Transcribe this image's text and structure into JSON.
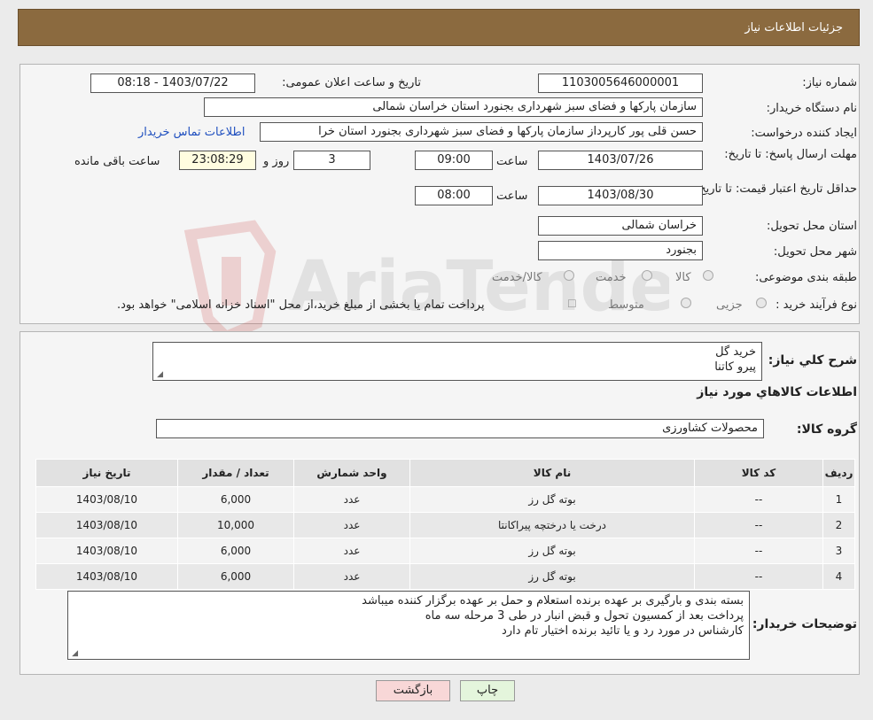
{
  "header": {
    "title": "جزئیات اطلاعات نیاز"
  },
  "form": {
    "need_number_label": "شماره نیاز:",
    "need_number": "1103005646000001",
    "announce_label": "تاریخ و ساعت اعلان عمومی:",
    "announce_value": "1403/07/22 - 08:18",
    "buyer_org_label": "نام دستگاه خریدار:",
    "buyer_org": "سازمان پارکها و فضای سبز شهرداری بجنورد استان خراسان شمالی",
    "requester_label": "ایجاد کننده درخواست:",
    "requester": "حسن  قلی پور  کارپرداز سازمان پارکها و فضای سبز شهرداری بجنورد استان خرا",
    "contact_link": "اطلاعات تماس خریدار",
    "deadline_label": "مهلت ارسال پاسخ: تا تاریخ:",
    "deadline_date": "1403/07/26",
    "time_word": "ساعت",
    "deadline_time": "09:00",
    "days": "3",
    "day_word": "روز و",
    "remaining": "23:08:29",
    "remaining_label": "ساعت باقی مانده",
    "validity_label": "حداقل تاریخ اعتبار قیمت: تا تاریخ:",
    "validity_date": "1403/08/30",
    "validity_time": "08:00",
    "province_label": "استان محل تحویل:",
    "province": "خراسان شمالی",
    "city_label": "شهر محل تحویل:",
    "city": "بجنورد",
    "category_label": "طبقه بندی موضوعی:",
    "category_options": [
      "کالا",
      "خدمت",
      "کالا/خدمت"
    ],
    "process_label": "نوع فرآیند خرید :",
    "process_options": [
      "جزیی",
      "متوسط"
    ],
    "process_note": "پرداخت تمام یا بخشی از مبلغ خرید،از محل \"اسناد خزانه اسلامی\" خواهد بود."
  },
  "summary": {
    "label": "شرح کلي نياز:",
    "lines": [
      "خرید گل",
      "پیرو کاتنا"
    ]
  },
  "goods": {
    "title": "اطلاعات کالاهاي مورد نياز",
    "group_label": "گروه کالا:",
    "group_value": "محصولات کشاورزی"
  },
  "table": {
    "headers": [
      "ردیف",
      "کد کالا",
      "نام کالا",
      "واحد شمارش",
      "تعداد / مقدار",
      "تاریخ نیاز"
    ],
    "rows": [
      [
        "1",
        "--",
        "بوته گل رز",
        "عدد",
        "6,000",
        "1403/08/10"
      ],
      [
        "2",
        "--",
        "درخت یا درختچه پیراکانتا",
        "عدد",
        "10,000",
        "1403/08/10"
      ],
      [
        "3",
        "--",
        "بوته گل رز",
        "عدد",
        "6,000",
        "1403/08/10"
      ],
      [
        "4",
        "--",
        "بوته گل رز",
        "عدد",
        "6,000",
        "1403/08/10"
      ]
    ]
  },
  "buyer_notes": {
    "label": "توضیحات خریدار:",
    "lines": [
      "بسته بندی و بارگیری بر عهده برنده استعلام و حمل بر عهده برگزار کننده میباشد",
      "پرداخت بعد از کمسیون تحول و قبض انبار در طی 3 مرحله  سه ماه",
      "کارشناس در مورد رد و یا تائید برنده اختیار تام دارد"
    ]
  },
  "buttons": {
    "print": "چاپ",
    "back": "بازگشت"
  },
  "watermark": {
    "text": "AriaTender.neT"
  },
  "colors": {
    "header": "#8b6a3f",
    "back_button": "#f8d7d7",
    "print_button": "#e4f5dc",
    "link": "#1f4fbf"
  }
}
